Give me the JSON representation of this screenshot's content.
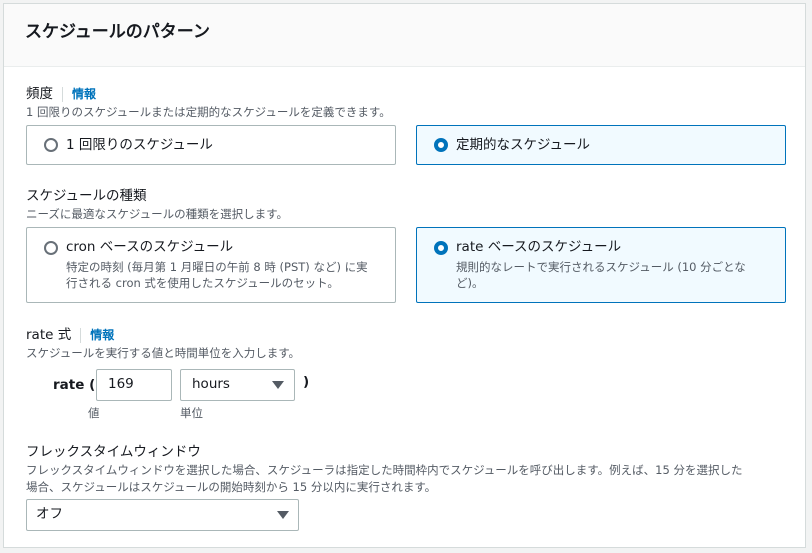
{
  "panel": {
    "title": "スケジュールのパターン"
  },
  "frequency": {
    "label": "頻度",
    "info": "情報",
    "description": "1 回限りのスケジュールまたは定期的なスケジュールを定義できます。",
    "options": [
      {
        "label": "1 回限りのスケジュール",
        "selected": false
      },
      {
        "label": "定期的なスケジュール",
        "selected": true
      }
    ]
  },
  "schedule_type": {
    "label": "スケジュールの種類",
    "description": "ニーズに最適なスケジュールの種類を選択します。",
    "options": [
      {
        "label": "cron ベースのスケジュール",
        "description": "特定の時刻 (毎月第 1 月曜日の午前 8 時 (PST) など) に実行される cron 式を使用したスケジュールのセット。",
        "selected": false
      },
      {
        "label": "rate ベースのスケジュール",
        "description": "規則的なレートで実行されるスケジュール (10 分ごとなど)。",
        "selected": true
      }
    ]
  },
  "rate_expression": {
    "label": "rate 式",
    "info": "情報",
    "description": "スケジュールを実行する値と時間単位を入力します。",
    "prefix": "rate (",
    "suffix": ")",
    "value": "169",
    "value_caption": "値",
    "unit": "hours",
    "unit_caption": "単位"
  },
  "flex_window": {
    "label": "フレックスタイムウィンドウ",
    "description_line1": "フレックスタイムウィンドウを選択した場合、スケジューラは指定した時間枠内でスケジュールを呼び出します。例えば、15 分を選択した",
    "description_line2": "場合、スケジュールはスケジュールの開始時刻から 15 分以内に実行されます。",
    "value": "オフ"
  },
  "colors": {
    "accent": "#0073bb",
    "selected_bg": "#f1faff",
    "border": "#aab7b8",
    "muted_text": "#545b64"
  }
}
